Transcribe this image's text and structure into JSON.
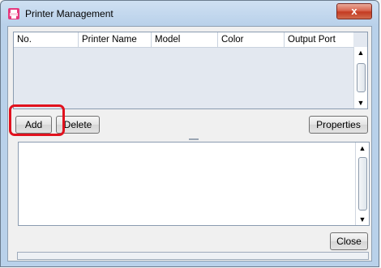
{
  "window": {
    "title": "Printer Management",
    "close_glyph": "x"
  },
  "printer_table": {
    "columns": [
      "No.",
      "Printer Name",
      "Model",
      "Color",
      "Output Port"
    ],
    "rows": []
  },
  "buttons": {
    "add": "Add",
    "delete": "Delete",
    "properties": "Properties",
    "close": "Close"
  },
  "icons": {
    "app": "printer-icon",
    "scroll_up": "▲",
    "scroll_down": "▼"
  },
  "colors": {
    "highlight": "#e1121e",
    "close_button": "#c43b22"
  }
}
